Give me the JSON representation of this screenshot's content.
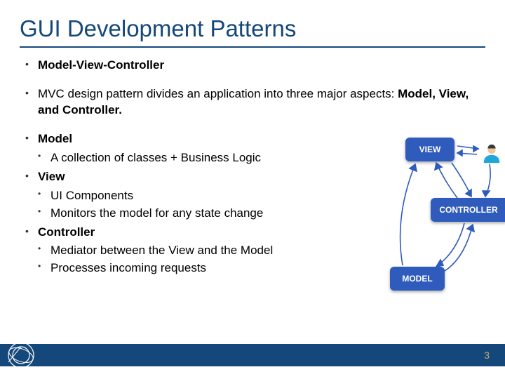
{
  "title": "GUI Development Patterns",
  "bullets": {
    "b1": "Model-View-Controller",
    "b2_pre": "MVC design pattern divides an application into three major aspects: ",
    "b2_bold": "Model, View, and Controller.",
    "b3": "Model",
    "b3_1": "A collection of classes + Business Logic",
    "b4": "View",
    "b4_1": "UI Components",
    "b4_2": "Monitors the model for any state change",
    "b5": "Controller",
    "b5_1": "Mediator between the View and the Model",
    "b5_2": "Processes incoming requests"
  },
  "diagram": {
    "view": "VIEW",
    "controller": "CONTROLLER",
    "model": "MODEL"
  },
  "page_number": "3"
}
